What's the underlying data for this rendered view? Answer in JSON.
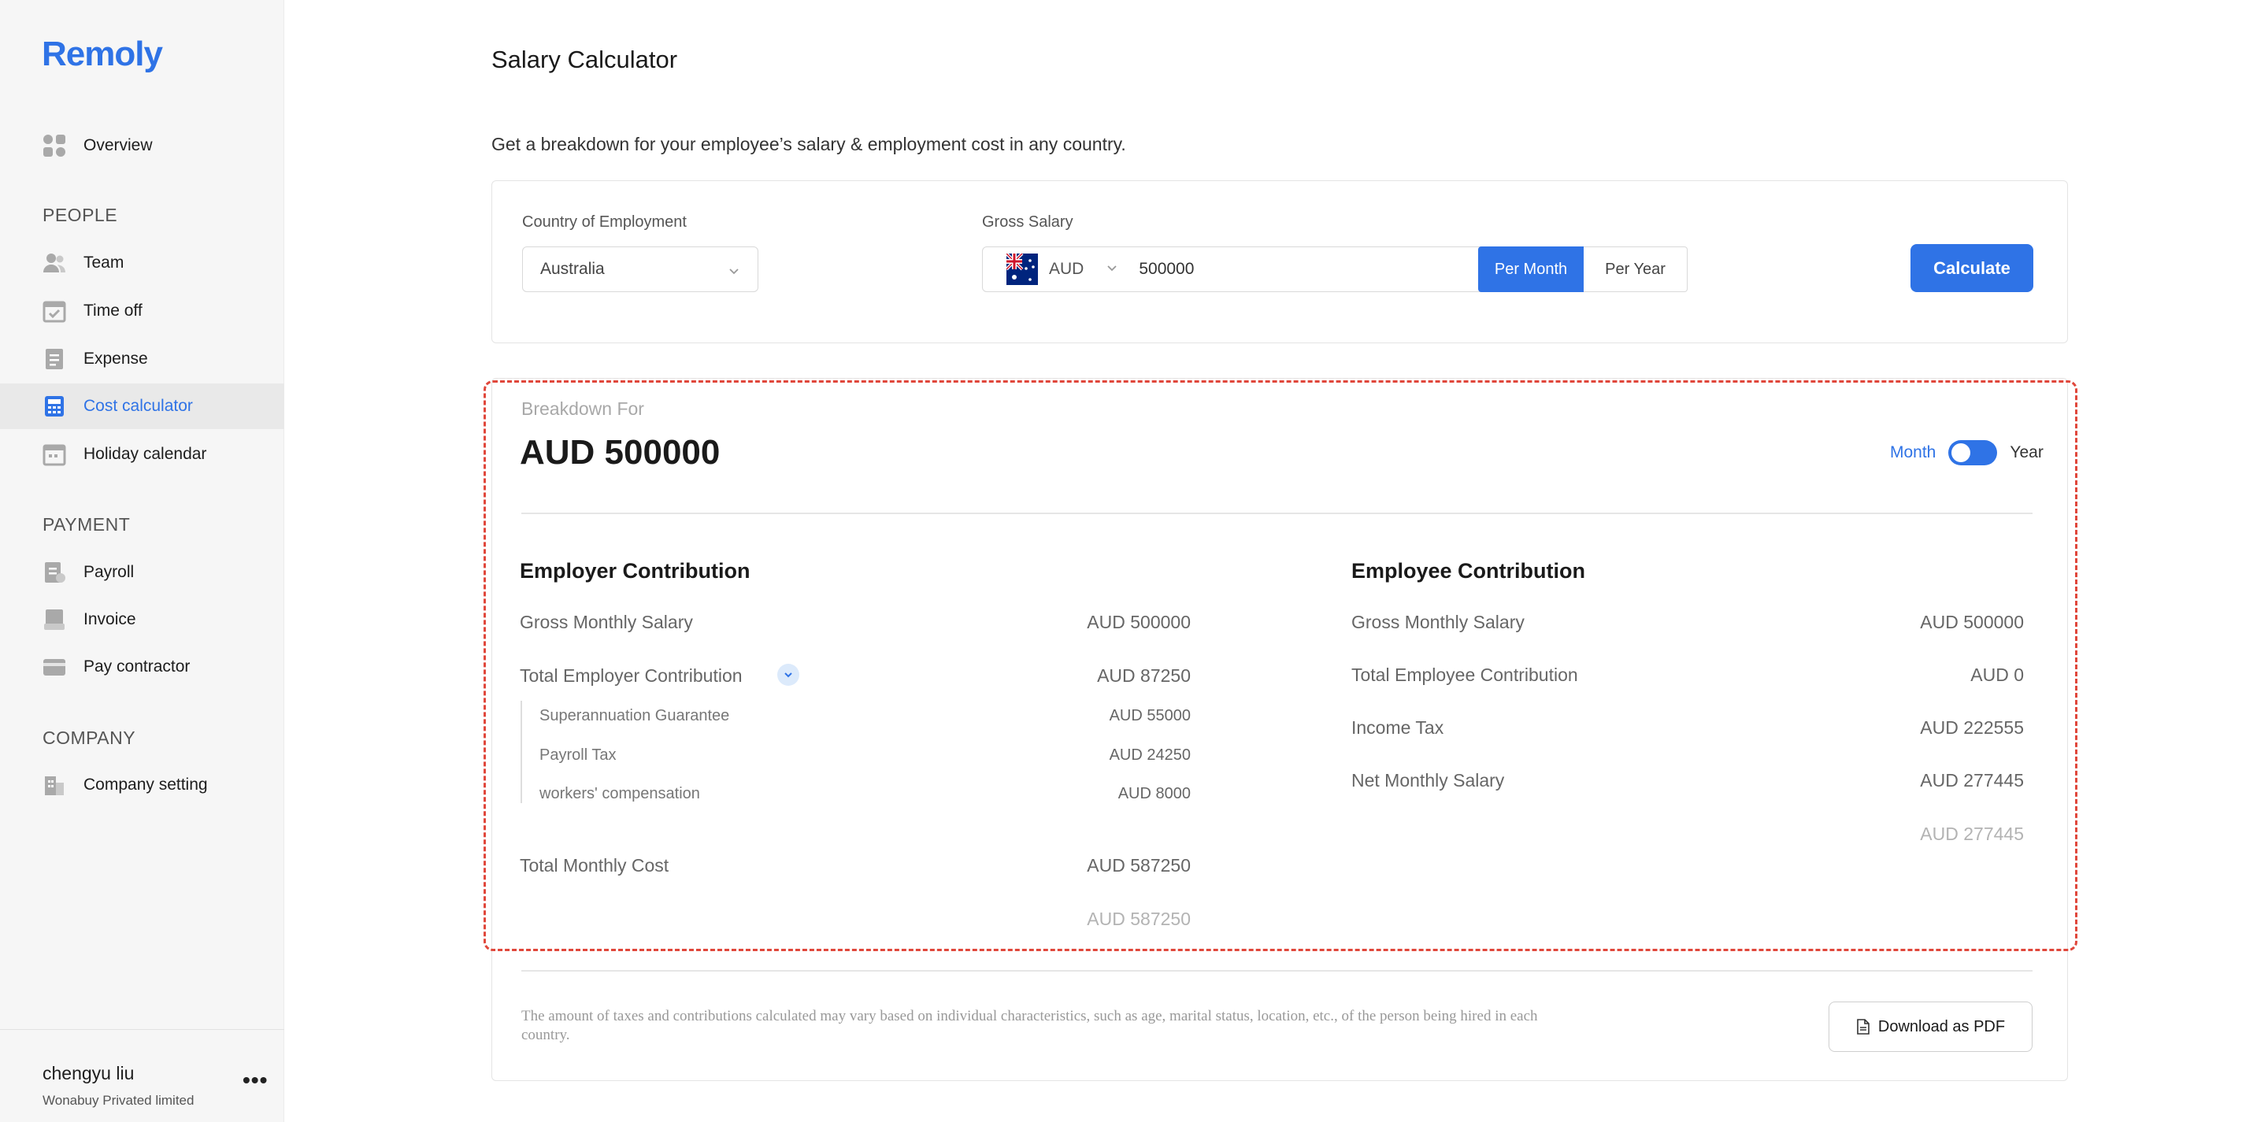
{
  "app": {
    "name": "Remoly"
  },
  "sidebar": {
    "overview": "Overview",
    "sections": {
      "people": "PEOPLE",
      "payment": "PAYMENT",
      "company": "COMPANY"
    },
    "people_items": [
      "Team",
      "Time off",
      "Expense",
      "Cost calculator",
      "Holiday calendar"
    ],
    "payment_items": [
      "Payroll",
      "Invoice",
      "Pay contractor"
    ],
    "company_items": [
      "Company setting"
    ],
    "active_item": "Cost calculator",
    "user": {
      "name": "chengyu liu",
      "company": "Wonabuy Privated limited",
      "more": "•••"
    }
  },
  "main": {
    "title": "Salary Calculator",
    "subtitle": "Get a breakdown for your employee’s salary & employment cost in any country."
  },
  "form": {
    "country_label": "Country of Employment",
    "country_value": "Australia",
    "salary_label": "Gross Salary",
    "currency": "AUD",
    "salary_value": "500000",
    "period_options": [
      "Per Month",
      "Per Year"
    ],
    "period_selected": "Per Month",
    "calculate_label": "Calculate"
  },
  "breakdown": {
    "for_label": "Breakdown For",
    "amount": "AUD 500000",
    "toggle": {
      "left": "Month",
      "right": "Year",
      "selected": "Month"
    },
    "employer": {
      "title": "Employer Contribution",
      "gross_label": "Gross Monthly Salary",
      "gross_value": "AUD 500000",
      "total_label": "Total Employer Contribution",
      "total_value": "AUD 87250",
      "items": [
        {
          "label": "Superannuation Guarantee",
          "value": "AUD 55000"
        },
        {
          "label": "Payroll Tax",
          "value": "AUD 24250"
        },
        {
          "label": "workers' compensation",
          "value": "AUD 8000"
        }
      ],
      "cost_label": "Total Monthly Cost",
      "cost_value": "AUD 587250",
      "cost_faded": "AUD 587250"
    },
    "employee": {
      "title": "Employee Contribution",
      "gross_label": "Gross Monthly Salary",
      "gross_value": "AUD 500000",
      "total_label": "Total Employee Contribution",
      "total_value": "AUD 0",
      "tax_label": "Income Tax",
      "tax_value": "AUD 222555",
      "net_label": "Net Monthly Salary",
      "net_value": "AUD 277445",
      "net_faded": "AUD 277445"
    }
  },
  "footer": {
    "disclaimer": "The amount of taxes and contributions calculated may vary based on individual characteristics, such as age, marital status, location, etc., of the person being hired in each country.",
    "download_label": "Download as PDF"
  },
  "colors": {
    "accent": "#2f73e6",
    "highlight_outline": "#e0473b"
  }
}
